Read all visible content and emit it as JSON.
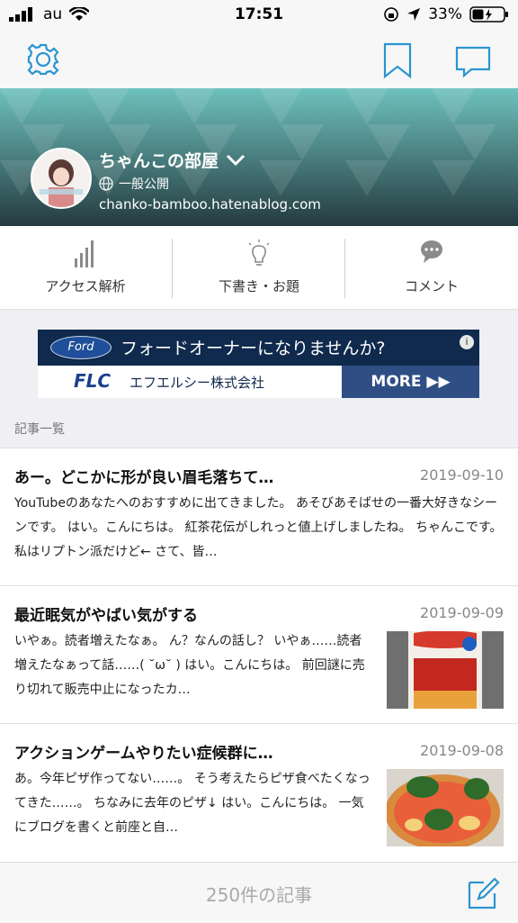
{
  "status_bar": {
    "carrier": "au",
    "time": "17:51",
    "battery": "33%"
  },
  "nav": {
    "settings_icon": "gear-icon",
    "bookmark_icon": "bookmark-icon",
    "comment_icon": "speech-bubble-icon"
  },
  "blog": {
    "title": "ちゃんこの部屋",
    "visibility": "一般公開",
    "url": "chanko-bamboo.hatenablog.com",
    "accent": "#4b9e9a"
  },
  "actions": [
    {
      "label": "アクセス解析",
      "icon": "bar-chart-icon"
    },
    {
      "label": "下書き・お題",
      "icon": "lightbulb-icon"
    },
    {
      "label": "コメント",
      "icon": "comment-icon"
    }
  ],
  "ad": {
    "brand": "Ford",
    "headline": "フォードオーナーになりませんか?",
    "logo_text": "FLC",
    "company": "エフエルシー株式会社",
    "cta": "MORE ▶▶"
  },
  "section_label": "記事一覧",
  "articles": [
    {
      "title": "あー。どこかに形が良い眉毛落ちて…",
      "date": "2019-09-10",
      "excerpt": "YouTubeのあなたへのおすすめに出てきました。 あそびあそばせの一番大好きなシーンです。 はい。こんにちは。 紅茶花伝がしれっと値上げしましたね。 ちゃんこです。 私はリプトン派だけど← さて、皆…"
    },
    {
      "title": "最近眠気がやばい気がする",
      "date": "2019-09-09",
      "excerpt": "いやぁ。読者増えたなぁ。 ん？なんの話し？ いやぁ……読者増えたなぁって話……( ˘ω˘ ) はい。こんにちは。 前回謎に売り切れて販売中止になったカ…"
    },
    {
      "title": "アクションゲームやりたい症候群に…",
      "date": "2019-09-08",
      "excerpt": "あ。今年ピザ作ってない……。 そう考えたらピザ食べたくなってきた……。 ちなみに去年のピザ↓ はい。こんにちは。 一気にブログを書くと前座と自…"
    }
  ],
  "footer": {
    "count": "250件の記事",
    "compose_icon": "compose-icon"
  }
}
